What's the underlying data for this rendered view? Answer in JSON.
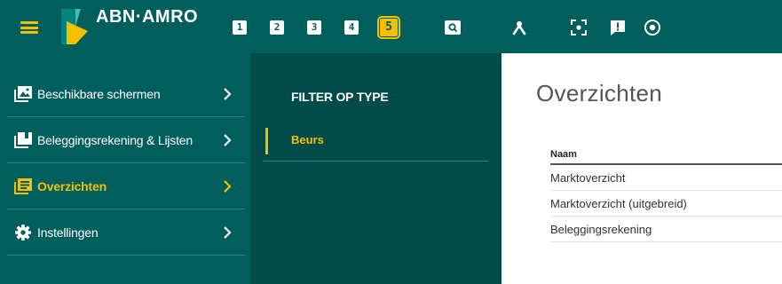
{
  "header": {
    "brand": "ABN·AMRO",
    "workspaces": [
      "1",
      "2",
      "3",
      "4",
      "5"
    ],
    "active_workspace": "5",
    "icons": [
      "menu-icon",
      "search-icon",
      "network-icon",
      "focus-icon",
      "message-icon",
      "target-icon"
    ],
    "colors": {
      "bar": "#005e5d",
      "accent": "#f3c000"
    }
  },
  "sidebar": {
    "items": [
      {
        "label": "Beschikbare schermen",
        "icon": "image-icon",
        "active": false
      },
      {
        "label": "Beleggingsrekening & Lijsten",
        "icon": "stack-icon",
        "active": false
      },
      {
        "label": "Overzichten",
        "icon": "list-icon",
        "active": true
      },
      {
        "label": "Instellingen",
        "icon": "gear-icon",
        "active": false
      }
    ]
  },
  "filter": {
    "heading": "FILTER OP TYPE",
    "items": [
      {
        "label": "Beurs",
        "selected": true
      }
    ]
  },
  "main": {
    "title": "Overzichten",
    "table": {
      "header": "Naam",
      "rows": [
        "Marktoverzicht",
        "Marktoverzicht (uitgebreid)",
        "Beleggingsrekening"
      ]
    }
  }
}
